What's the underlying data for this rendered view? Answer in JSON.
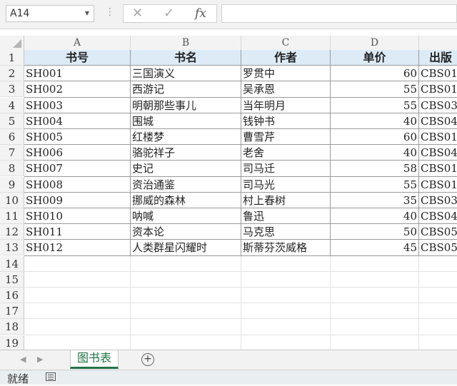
{
  "formula_bar": {
    "name_box": "A14",
    "formula": "",
    "cancel_icon": "✕",
    "enter_icon": "✓",
    "fx_label": "fx"
  },
  "columns": [
    "A",
    "B",
    "C",
    "D",
    ""
  ],
  "rows": [
    {
      "n": "1",
      "cells": [
        "书号",
        "书名",
        "作者",
        "单价",
        "出版"
      ]
    },
    {
      "n": "2",
      "cells": [
        "SH001",
        "三国演义",
        "罗贯中",
        "60",
        "CBS01"
      ]
    },
    {
      "n": "3",
      "cells": [
        "SH002",
        "西游记",
        "吴承恩",
        "55",
        "CBS01"
      ]
    },
    {
      "n": "4",
      "cells": [
        "SH003",
        "明朝那些事儿",
        "当年明月",
        "55",
        "CBS03"
      ]
    },
    {
      "n": "5",
      "cells": [
        "SH004",
        "围城",
        "钱钟书",
        "40",
        "CBS04"
      ]
    },
    {
      "n": "6",
      "cells": [
        "SH005",
        "红楼梦",
        "曹雪芹",
        "60",
        "CBS01"
      ]
    },
    {
      "n": "7",
      "cells": [
        "SH006",
        "骆驼祥子",
        "老舍",
        "40",
        "CBS04"
      ]
    },
    {
      "n": "8",
      "cells": [
        "SH007",
        "史记",
        "司马迁",
        "58",
        "CBS01"
      ]
    },
    {
      "n": "9",
      "cells": [
        "SH008",
        "资治通鉴",
        "司马光",
        "55",
        "CBS01"
      ]
    },
    {
      "n": "10",
      "cells": [
        "SH009",
        "挪威的森林",
        "村上春树",
        "35",
        "CBS03"
      ]
    },
    {
      "n": "11",
      "cells": [
        "SH010",
        "呐喊",
        "鲁迅",
        "40",
        "CBS04"
      ]
    },
    {
      "n": "12",
      "cells": [
        "SH011",
        "资本论",
        "马克思",
        "50",
        "CBS05"
      ]
    },
    {
      "n": "13",
      "cells": [
        "SH012",
        "人类群星闪耀时",
        "斯蒂芬茨威格",
        "45",
        "CBS05"
      ]
    },
    {
      "n": "14",
      "cells": [
        "",
        "",
        "",
        "",
        ""
      ]
    },
    {
      "n": "15",
      "cells": [
        "",
        "",
        "",
        "",
        ""
      ]
    },
    {
      "n": "16",
      "cells": [
        "",
        "",
        "",
        "",
        ""
      ]
    },
    {
      "n": "17",
      "cells": [
        "",
        "",
        "",
        "",
        ""
      ]
    },
    {
      "n": "18",
      "cells": [
        "",
        "",
        "",
        "",
        ""
      ]
    },
    {
      "n": "19",
      "cells": [
        "",
        "",
        "",
        "",
        ""
      ]
    }
  ],
  "sheet_tabs": [
    "图书表"
  ],
  "nav": {
    "prev": "◀",
    "next": "▶",
    "add": "+"
  },
  "status": {
    "text": "就绪"
  },
  "colors": {
    "header_fill": "#ddebf7",
    "tab_accent": "#217346"
  }
}
